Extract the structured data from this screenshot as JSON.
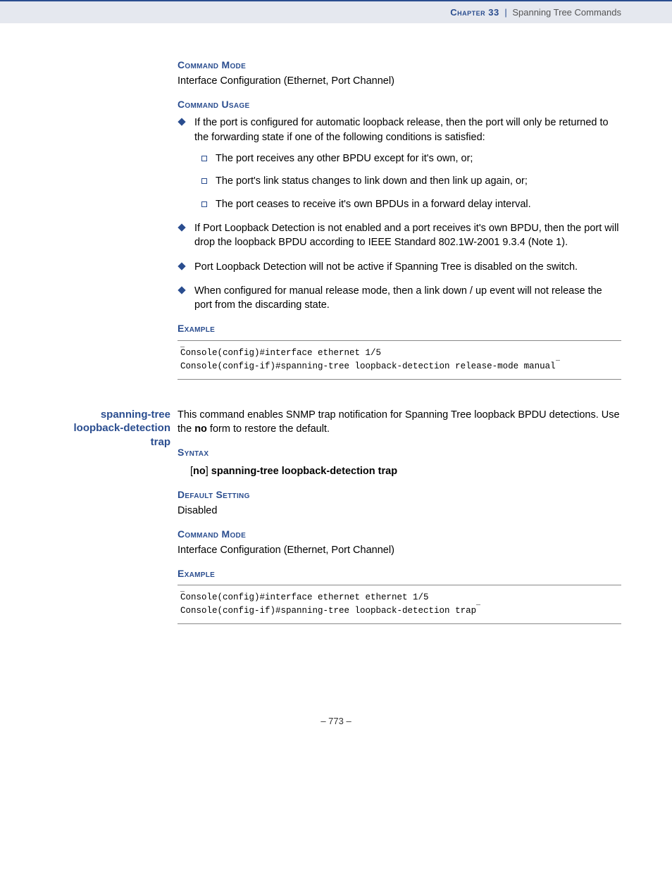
{
  "header": {
    "chapter": "Chapter 33",
    "separator": "|",
    "title": "Spanning Tree Commands"
  },
  "section1": {
    "h_command_mode": "Command Mode",
    "command_mode_text": "Interface Configuration (Ethernet, Port Channel)",
    "h_command_usage": "Command Usage",
    "usage_items": {
      "0": "If the port is configured for automatic loopback release, then the port will only be returned to the forwarding state if one of the following conditions is satisfied:",
      "0_sub": {
        "a": "The port receives any other BPDU except for it's own, or;",
        "b": "The port's link status changes to link down and then link up again, or;",
        "c": "The port ceases to receive it's own BPDUs in a forward delay interval."
      },
      "1": "If Port Loopback Detection is not enabled and a port receives it's own BPDU, then the port will drop the loopback BPDU according to IEEE Standard 802.1W-2001 9.3.4 (Note 1).",
      "2": "Port Loopback Detection will not be active if Spanning Tree is disabled on the switch.",
      "3": "When configured for manual release mode, then a link down / up event will not release the port from the discarding state."
    },
    "h_example": "Example",
    "example_code": "Console(config)#interface ethernet 1/5\nConsole(config-if)#spanning-tree loopback-detection release-mode manual"
  },
  "section2": {
    "side_label": "spanning-tree loopback-detection trap",
    "intro_pre": "This command enables SNMP trap notification for Spanning Tree loopback BPDU detections. Use the ",
    "intro_bold": "no",
    "intro_post": " form to restore the default.",
    "h_syntax": "Syntax",
    "syntax_bracket_open": "[",
    "syntax_no": "no",
    "syntax_bracket_close": "]",
    "syntax_rest": " spanning-tree loopback-detection trap",
    "h_default": "Default Setting",
    "default_text": "Disabled",
    "h_command_mode": "Command Mode",
    "command_mode_text": "Interface Configuration (Ethernet, Port Channel)",
    "h_example": "Example",
    "example_code": "Console(config)#interface ethernet ethernet 1/5\nConsole(config-if)#spanning-tree loopback-detection trap"
  },
  "footer": {
    "page": "–  773  –"
  }
}
